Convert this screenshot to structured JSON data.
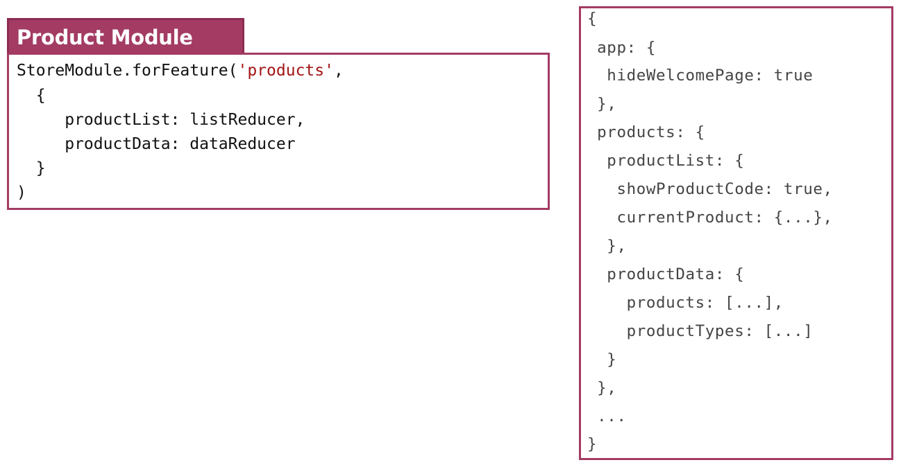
{
  "module_title": "Product Module",
  "feature_code": {
    "line1_prefix": "StoreModule.forFeature(",
    "line1_string": "'products'",
    "line1_suffix": ",",
    "line2": "  {",
    "line3": "     productList: listReducer,",
    "line4": "     productData: dataReducer",
    "line5": "  }",
    "line6": ")"
  },
  "state_tree": [
    "{",
    " app: {",
    "  hideWelcomePage: true",
    " },",
    " products: {",
    "  productList: {",
    "   showProductCode: true,",
    "   currentProduct: {...},",
    "  },",
    "  productData: {",
    "    products: [...],",
    "    productTypes: [...]",
    "  }",
    " },",
    " ...",
    "}"
  ]
}
